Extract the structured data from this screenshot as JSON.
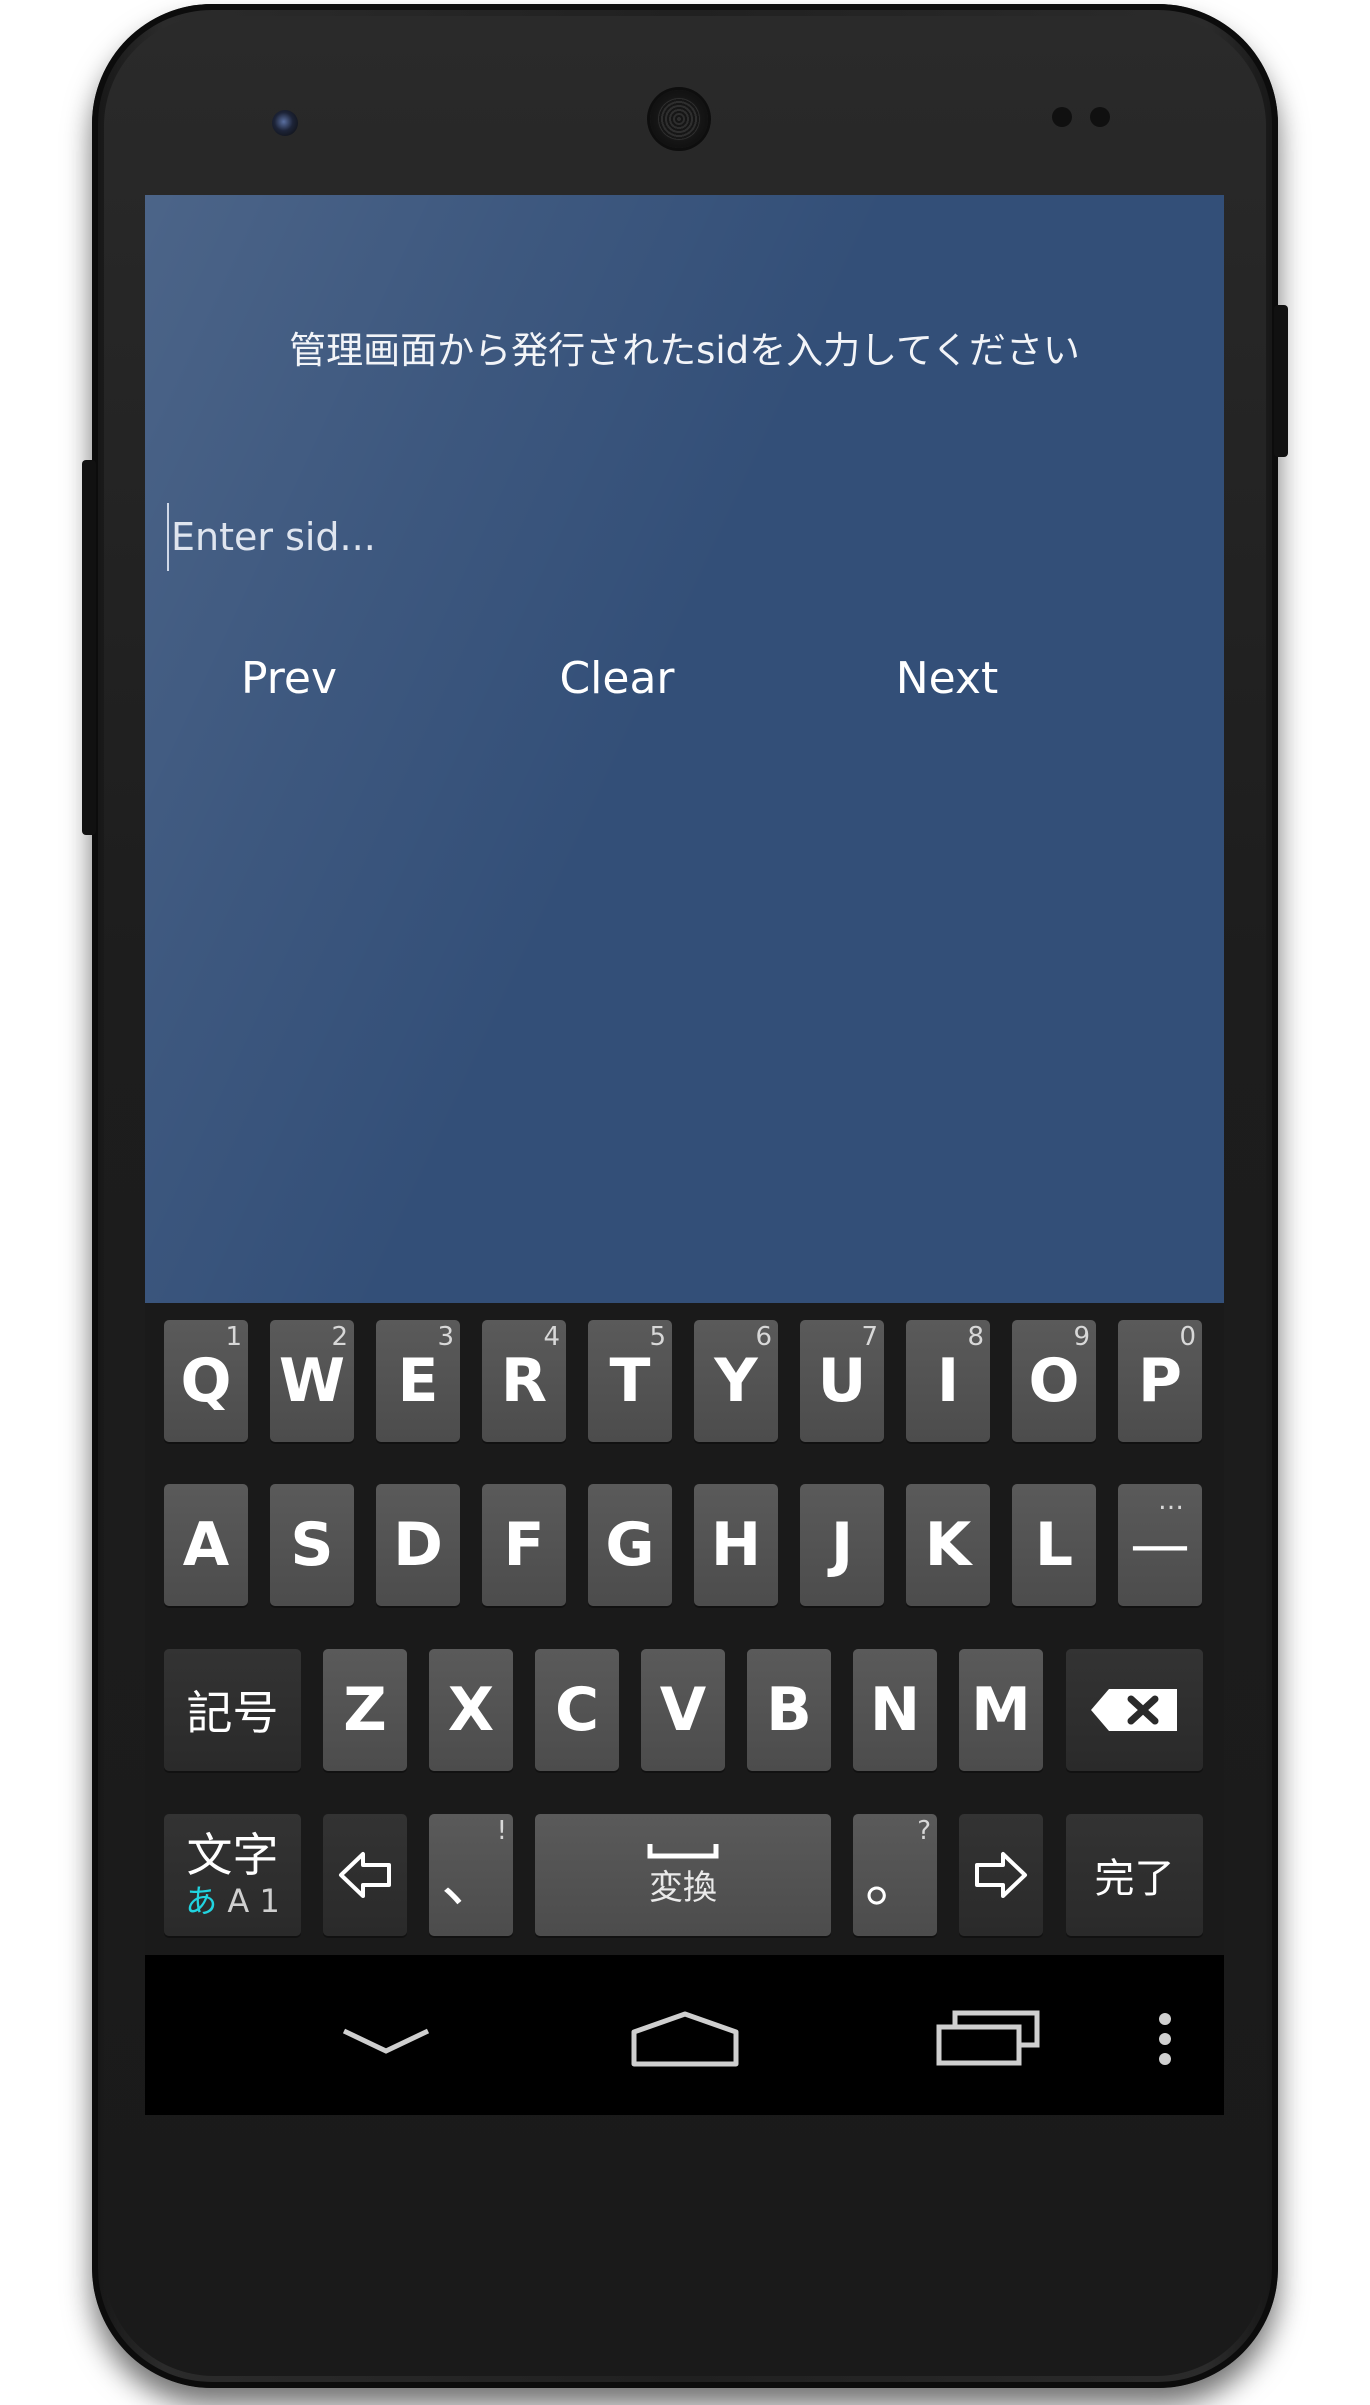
{
  "app": {
    "prompt": "管理画面から発行されたsidを入力してください",
    "sid_placeholder": "Enter sid...",
    "buttons": {
      "prev": "Prev",
      "clear": "Clear",
      "next": "Next"
    }
  },
  "keyboard": {
    "row1": [
      {
        "label": "Q",
        "hint": "1"
      },
      {
        "label": "W",
        "hint": "2"
      },
      {
        "label": "E",
        "hint": "3"
      },
      {
        "label": "R",
        "hint": "4"
      },
      {
        "label": "T",
        "hint": "5"
      },
      {
        "label": "Y",
        "hint": "6"
      },
      {
        "label": "U",
        "hint": "7"
      },
      {
        "label": "I",
        "hint": "8"
      },
      {
        "label": "O",
        "hint": "9"
      },
      {
        "label": "P",
        "hint": "0"
      }
    ],
    "row2": [
      {
        "label": "A"
      },
      {
        "label": "S"
      },
      {
        "label": "D"
      },
      {
        "label": "F"
      },
      {
        "label": "G"
      },
      {
        "label": "H"
      },
      {
        "label": "J"
      },
      {
        "label": "K"
      },
      {
        "label": "L"
      },
      {
        "label": "—",
        "hint": "…"
      }
    ],
    "row3": {
      "symbols": "記号",
      "letters": [
        "Z",
        "X",
        "C",
        "V",
        "B",
        "N",
        "M"
      ]
    },
    "row4": {
      "mode_top": "文字",
      "mode_active": "あ",
      "mode_rest": "A 1",
      "comma": "、",
      "comma_hint": "!",
      "space": "変換",
      "period": "。",
      "period_hint": "?",
      "done": "完了"
    }
  },
  "colors": {
    "app_bg": "#334f78",
    "keyboard_bg": "#1a1a1a",
    "key_bg": "#4c4c4c",
    "mode_accent": "#21d4e0"
  },
  "icons": [
    "backspace-icon",
    "left-arrow-icon",
    "right-arrow-icon",
    "back-icon",
    "home-icon",
    "recents-icon",
    "overflow-menu-icon"
  ]
}
